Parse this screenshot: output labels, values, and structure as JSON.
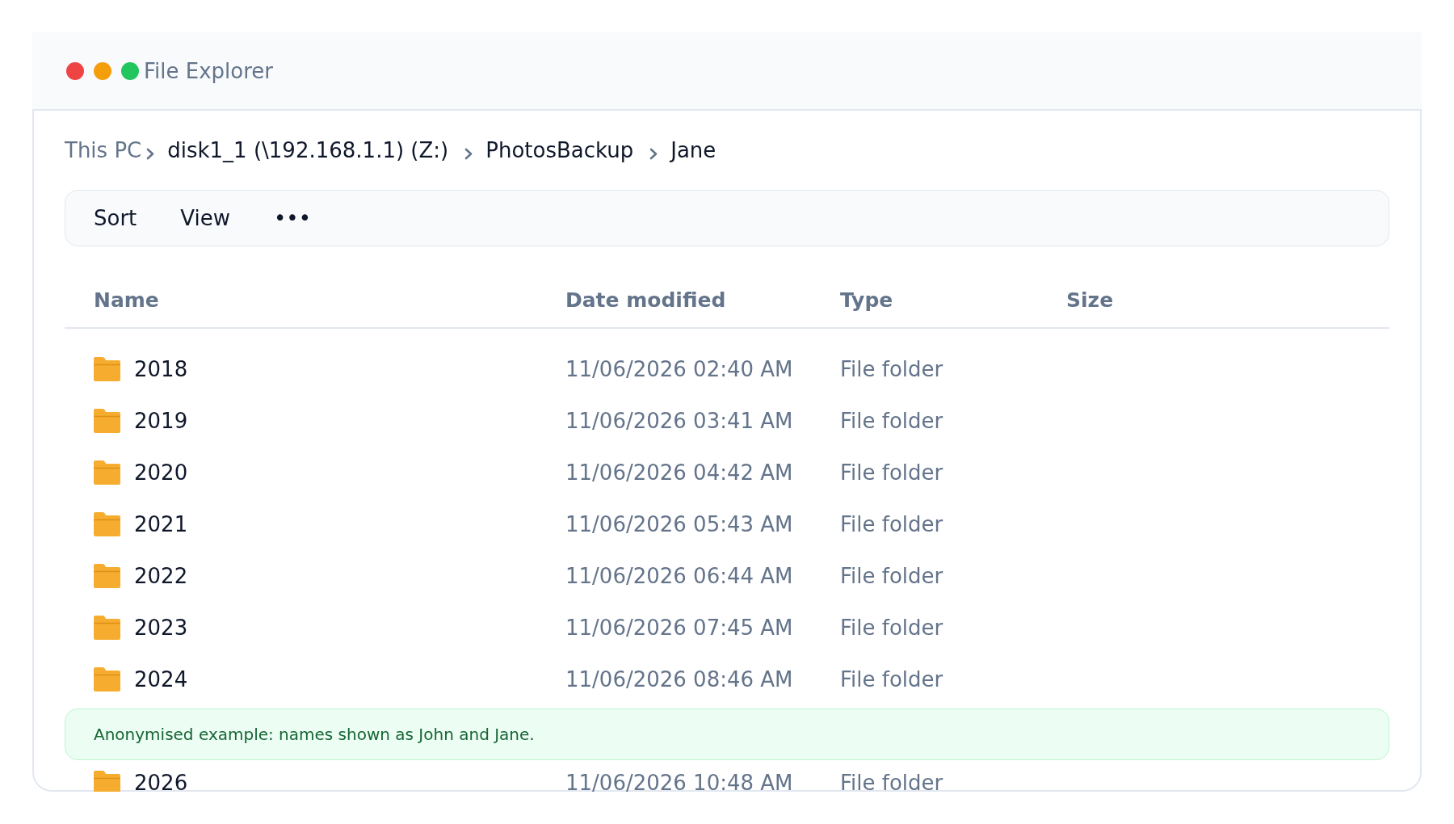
{
  "window": {
    "title": "File Explorer",
    "controls": [
      {
        "color": "#ef4444"
      },
      {
        "color": "#f59e0b"
      },
      {
        "color": "#22c55e"
      }
    ]
  },
  "breadcrumb": [
    {
      "label": "This PC",
      "kind": "root"
    },
    {
      "label": "disk1_1 (\\192.168.1.1) (Z:)",
      "kind": "folder"
    },
    {
      "label": "PhotosBackup",
      "kind": "folder"
    },
    {
      "label": "Jane",
      "kind": "folder"
    }
  ],
  "toolbar": [
    "Sort",
    "View",
    "•••"
  ],
  "table": {
    "columns": [
      "Name",
      "Date modified",
      "Type",
      "Size"
    ],
    "rows": [
      {
        "kind": "folder",
        "name": "2018",
        "date_modified": "11/06/2026 02:40 AM",
        "type": "File folder"
      },
      {
        "kind": "folder",
        "name": "2019",
        "date_modified": "11/06/2026 03:41 AM",
        "type": "File folder"
      },
      {
        "kind": "folder",
        "name": "2020",
        "date_modified": "11/06/2026 04:42 AM",
        "type": "File folder"
      },
      {
        "kind": "folder",
        "name": "2021",
        "date_modified": "11/06/2026 05:43 AM",
        "type": "File folder"
      },
      {
        "kind": "folder",
        "name": "2022",
        "date_modified": "11/06/2026 06:44 AM",
        "type": "File folder"
      },
      {
        "kind": "folder",
        "name": "2023",
        "date_modified": "11/06/2026 07:45 AM",
        "type": "File folder"
      },
      {
        "kind": "folder",
        "name": "2024",
        "date_modified": "11/06/2026 08:46 AM",
        "type": "File folder"
      },
      {
        "kind": "notice",
        "text": "Anonymised example: names shown as John and Jane."
      },
      {
        "kind": "folder",
        "name": "2026",
        "date_modified": "11/06/2026 10:48 AM",
        "type": "File folder"
      }
    ]
  }
}
